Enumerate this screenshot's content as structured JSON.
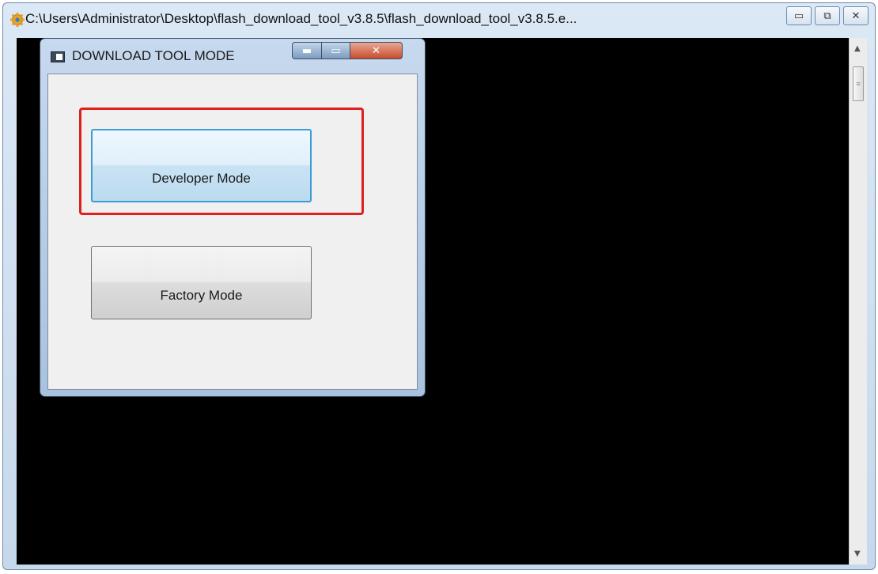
{
  "console_window": {
    "title": "C:\\Users\\Administrator\\Desktop\\flash_download_tool_v3.8.5\\flash_download_tool_v3.8.5.e...",
    "controls": {
      "minimize": "▭",
      "maximize": "⧉",
      "close": "✕"
    },
    "scrollbar": {
      "up": "▲",
      "down": "▼",
      "grip": "≡"
    }
  },
  "dialog": {
    "title": "DOWNLOAD TOOL MODE",
    "controls": {
      "minimize": "▬",
      "maximize": "▭",
      "close": "✕"
    },
    "buttons": {
      "developer": "Developer Mode",
      "factory": "Factory Mode"
    }
  },
  "colors": {
    "console_bg": "#000000",
    "highlight": "#e0201c",
    "focus_border": "#3c9dd6"
  },
  "icons": {
    "app": "gear-icon",
    "dialog": "window-icon"
  }
}
